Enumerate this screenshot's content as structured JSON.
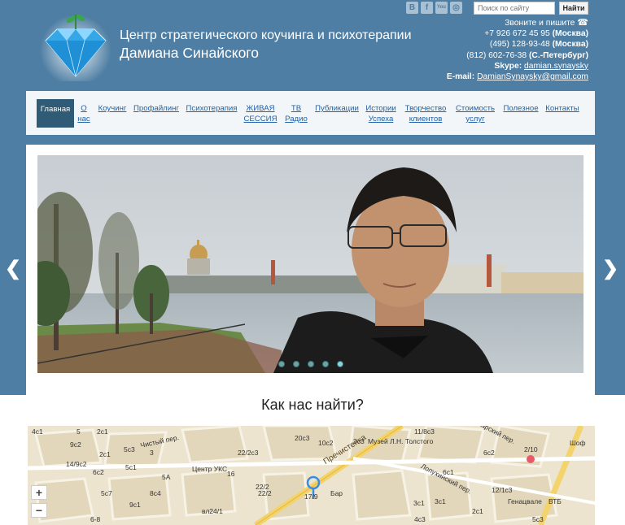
{
  "header": {
    "brand_line1": "Центр стратегического коучинга и психотерапии",
    "brand_line2": "Дамиана Синайского"
  },
  "social": [
    "vk-icon",
    "facebook-icon",
    "youtube-icon",
    "instagram-icon"
  ],
  "search": {
    "placeholder": "Поиск по сайту",
    "button": "Найти"
  },
  "contacts": {
    "call_text": "Звоните и пишите",
    "phone1": "+7 926 672 45 95",
    "phone1_city": "(Москва)",
    "phone2": "(495) 128-93-48",
    "phone2_city": "(Москва)",
    "phone3": "(812) 602-76-38",
    "phone3_city": "(С.-Петербург)",
    "skype_label": "Skype:",
    "skype": "damian.synaysky",
    "email_label": "E-mail:",
    "email": "DamianSynaysky@gmail.com"
  },
  "nav": [
    {
      "line1": "Главная",
      "line2": ""
    },
    {
      "line1": "О",
      "line2": "нас"
    },
    {
      "line1": "Коучинг",
      "line2": ""
    },
    {
      "line1": "Профайлинг",
      "line2": ""
    },
    {
      "line1": "Психотерапия",
      "line2": ""
    },
    {
      "line1": "ЖИВАЯ",
      "line2": "СЕССИЯ"
    },
    {
      "line1": "ТВ",
      "line2": "Радио"
    },
    {
      "line1": "Публикации",
      "line2": ""
    },
    {
      "line1": "Истории",
      "line2": "Успеха"
    },
    {
      "line1": "Творчество",
      "line2": "клиентов"
    },
    {
      "line1": "Стоимость",
      "line2": "услуг"
    },
    {
      "line1": "Полезное",
      "line2": ""
    },
    {
      "line1": "Контакты",
      "line2": ""
    }
  ],
  "slider": {
    "dots": 5,
    "active_dot": 5,
    "prev_icon": "chevron-left-icon",
    "next_icon": "chevron-right-icon"
  },
  "find": {
    "title": "Как нас найти?"
  },
  "map": {
    "labels": [
      "4с1",
      "5",
      "9с2",
      "2с1",
      "2с1",
      "5с3",
      "3",
      "Чистый пер.",
      "Центр УКС",
      "22/2с3",
      "20с3",
      "10с2",
      "3с3",
      "Пречистенка",
      "Музей Л.Н. Толстого",
      "11/8с3",
      "Пожарский пер.",
      "6с2",
      "2/10",
      "Шоф",
      "14/9с2",
      "6с2",
      "5с1",
      "5А",
      "16",
      "22/2",
      "Бар",
      "Лопухинский пер.",
      "6с1",
      "12/1с3",
      "ВТБ",
      "5с7",
      "9с1",
      "8с4",
      "22/2",
      "17/9",
      "3с1",
      "3с1",
      "Генацвале",
      "6-8",
      "вл24/1",
      "4с3",
      "2с1",
      "5с3"
    ],
    "zoom_in": "+",
    "zoom_out": "−"
  },
  "colors": {
    "band": "#4e7ea3",
    "nav_bg": "#f2f6f8",
    "nav_active": "#2f5b77",
    "link": "#1f62a8"
  }
}
